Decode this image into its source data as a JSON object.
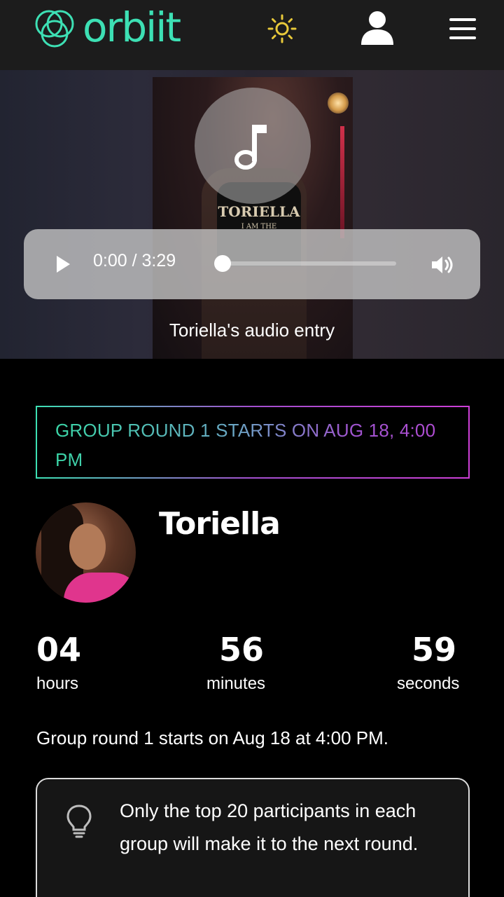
{
  "header": {
    "logo_text": "orbiit",
    "icons": {
      "logo": "orbit-rings-logo",
      "theme": "sun-icon",
      "account": "user-icon",
      "menu": "hamburger-menu-icon"
    },
    "colors": {
      "brand": "#3de0b4",
      "sun": "#e8c93a"
    }
  },
  "media": {
    "shirt_text": "TORIELLA",
    "shirt_subtext": "I AM THE",
    "player": {
      "time": "0:00 / 3:29",
      "progress": 0
    },
    "caption": "Toriella's audio entry"
  },
  "announcement": {
    "text": "GROUP ROUND 1 STARTS ON AUG 18, 4:00 PM"
  },
  "profile": {
    "name": "Toriella"
  },
  "countdown": {
    "hours": "04",
    "hours_label": "hours",
    "minutes": "56",
    "minutes_label": "minutes",
    "seconds": "59",
    "seconds_label": "seconds"
  },
  "info_line": "Group round 1 starts on Aug 18 at 4:00 PM.",
  "tip": {
    "icon": "lightbulb-icon",
    "text": "Only the top 20 participants in each group will make it to the next round."
  }
}
